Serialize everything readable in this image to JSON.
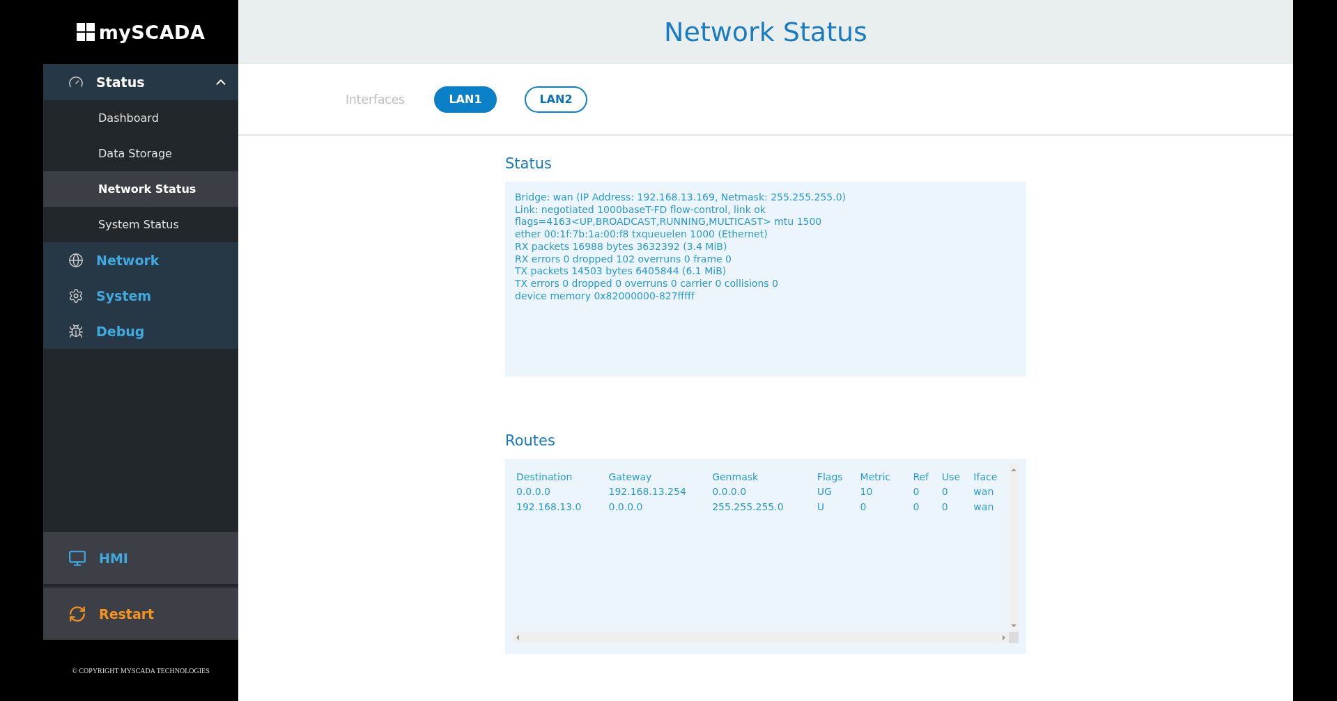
{
  "logo": {
    "text": "mySCADA"
  },
  "sidebar": {
    "sections": [
      {
        "label": "Status",
        "expanded": true,
        "children": [
          {
            "label": "Dashboard",
            "selected": false
          },
          {
            "label": "Data Storage",
            "selected": false
          },
          {
            "label": "Network Status",
            "selected": true
          },
          {
            "label": "System Status",
            "selected": false
          }
        ]
      },
      {
        "label": "Network",
        "expanded": false
      },
      {
        "label": "System",
        "expanded": false
      },
      {
        "label": "Debug",
        "expanded": false
      }
    ],
    "bottom": [
      {
        "label": "HMI",
        "kind": "hmi"
      },
      {
        "label": "Restart",
        "kind": "restart"
      }
    ],
    "copyright": "© COPYRIGHT MYSCADA TECHNOLOGIES"
  },
  "header": {
    "title": "Network Status"
  },
  "interfaces": {
    "label": "Interfaces",
    "tabs": [
      {
        "label": "LAN1",
        "selected": true
      },
      {
        "label": "LAN2",
        "selected": false
      }
    ]
  },
  "status": {
    "title": "Status",
    "lines": [
      "Bridge: wan (IP Address: 192.168.13.169, Netmask: 255.255.255.0)",
      "Link: negotiated 1000baseT-FD flow-control, link ok",
      "flags=4163<UP,BROADCAST,RUNNING,MULTICAST> mtu 1500",
      "ether 00:1f:7b:1a:00:f8 txqueuelen 1000 (Ethernet)",
      "RX packets 16988 bytes 3632392 (3.4 MiB)",
      "RX errors 0 dropped 102 overruns 0 frame 0",
      "TX packets 14503 bytes 6405844 (6.1 MiB)",
      "TX errors 0 dropped 0 overruns 0 carrier 0 collisions 0",
      "device memory 0x82000000-827fffff"
    ]
  },
  "routes": {
    "title": "Routes",
    "columns": [
      "Destination",
      "Gateway",
      "Genmask",
      "Flags",
      "Metric",
      "Ref",
      "Use",
      "Iface"
    ],
    "rows": [
      [
        "0.0.0.0",
        "192.168.13.254",
        "0.0.0.0",
        "UG",
        "10",
        "0",
        "0",
        "wan"
      ],
      [
        "192.168.13.0",
        "0.0.0.0",
        "255.255.255.0",
        "U",
        "0",
        "0",
        "0",
        "wan"
      ]
    ]
  }
}
